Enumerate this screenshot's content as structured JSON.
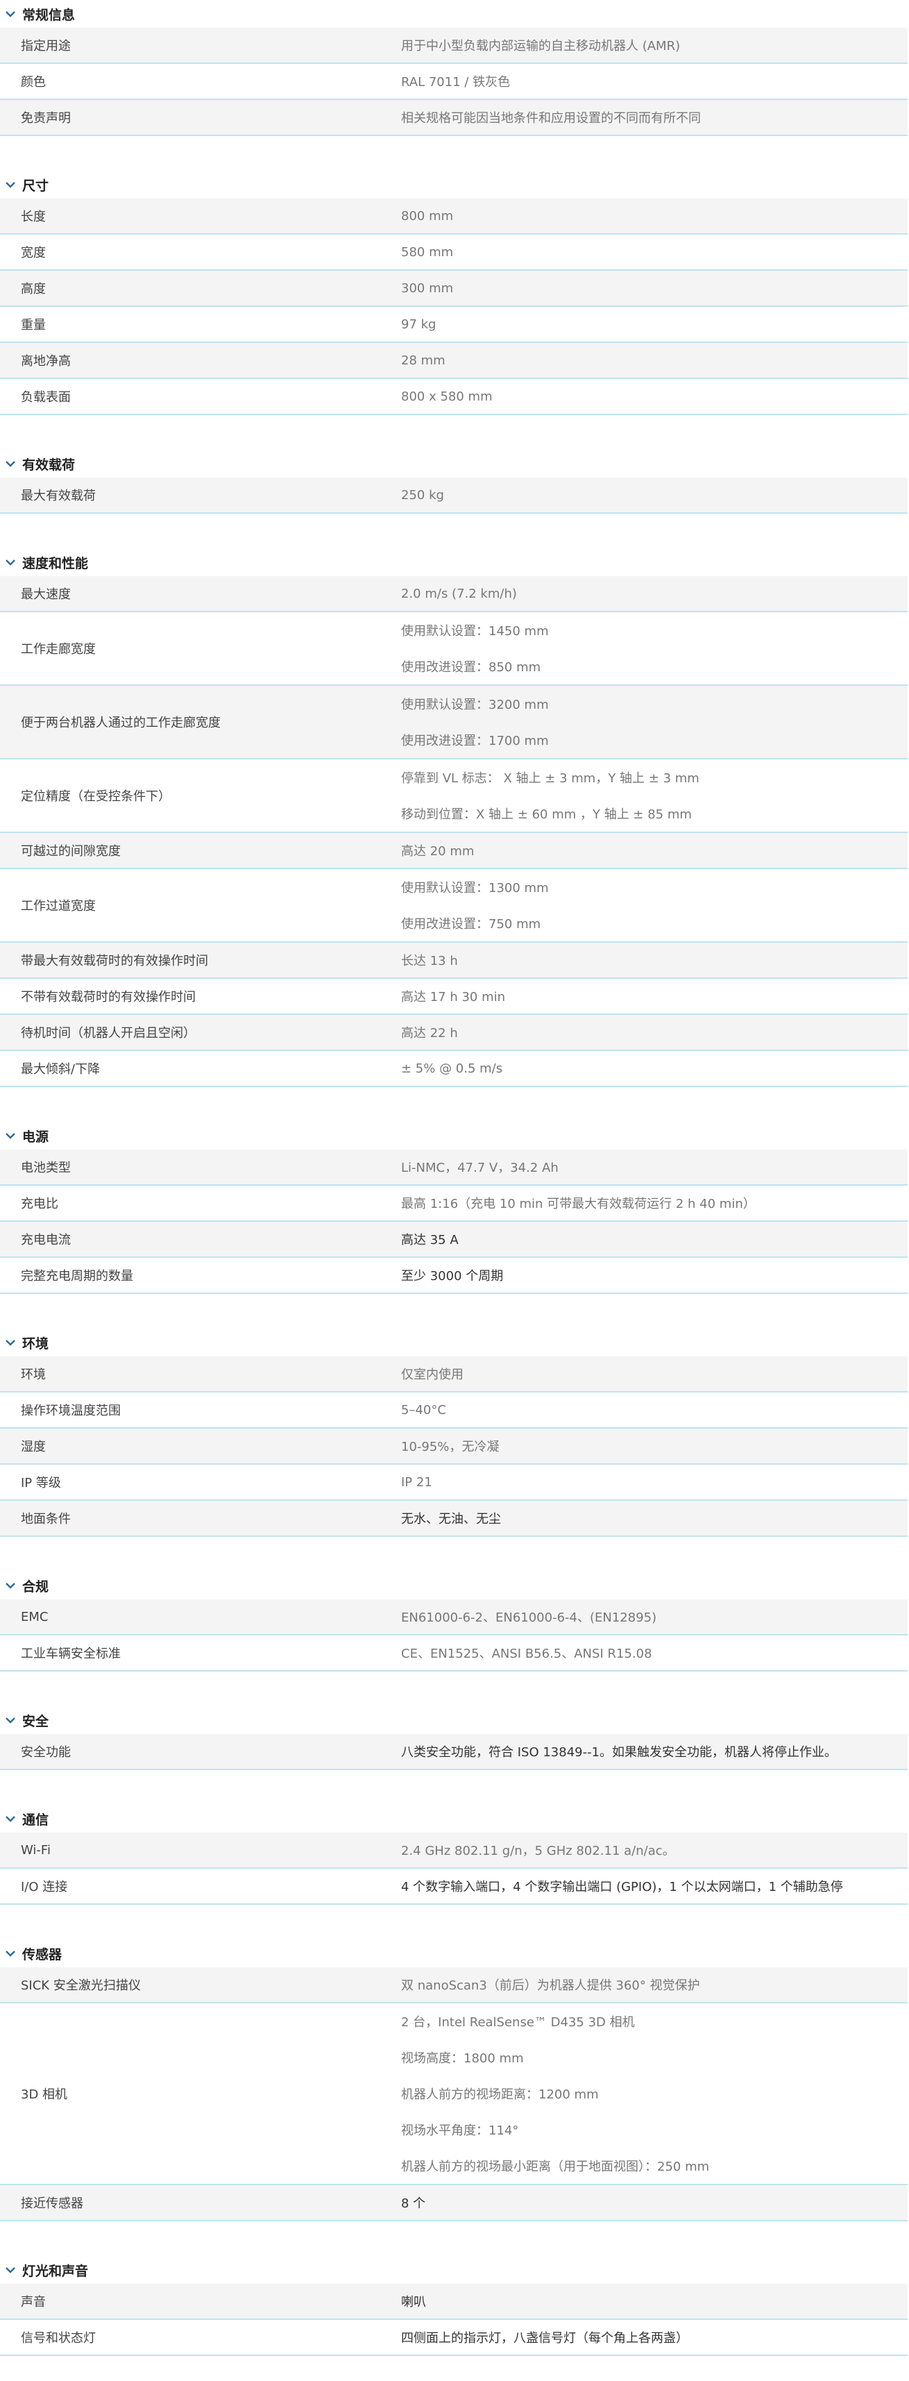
{
  "sections": [
    {
      "title": "常规信息",
      "rows": [
        {
          "k": "指定用途",
          "v": [
            "用于中小型负载内部运输的自主移动机器人 (AMR)"
          ]
        },
        {
          "k": "颜色",
          "v": [
            "RAL 7011 / 铁灰色"
          ]
        },
        {
          "k": "免责声明",
          "v": [
            "相关规格可能因当地条件和应用设置的不同而有所不同"
          ]
        }
      ]
    },
    {
      "title": "尺寸",
      "rows": [
        {
          "k": "长度",
          "v": [
            "800 mm"
          ]
        },
        {
          "k": "宽度",
          "v": [
            "580 mm"
          ]
        },
        {
          "k": "高度",
          "v": [
            "300 mm"
          ]
        },
        {
          "k": "重量",
          "v": [
            "97 kg"
          ]
        },
        {
          "k": "离地净高",
          "v": [
            "28 mm"
          ]
        },
        {
          "k": "负载表面",
          "v": [
            "800 x 580 mm"
          ]
        }
      ]
    },
    {
      "title": "有效载荷",
      "rows": [
        {
          "k": "最大有效载荷",
          "v": [
            "250 kg"
          ]
        }
      ]
    },
    {
      "title": "速度和性能",
      "rows": [
        {
          "k": "最大速度",
          "v": [
            "2.0 m/s (7.2 km/h)"
          ]
        },
        {
          "k": "工作走廊宽度",
          "v": [
            "使用默认设置：1450 mm",
            "使用改进设置：850 mm"
          ]
        },
        {
          "k": "便于两台机器人通过的工作走廊宽度",
          "v": [
            "使用默认设置：3200 mm",
            "使用改进设置：1700 mm"
          ]
        },
        {
          "k": "定位精度（在受控条件下）",
          "v": [
            "停靠到 VL 标志： X 轴上 ± 3 mm，Y 轴上 ± 3 mm",
            "移动到位置：X 轴上 ± 60 mm ，Y 轴上 ± 85 mm"
          ]
        },
        {
          "k": "可越过的间隙宽度",
          "v": [
            "高达 20 mm"
          ]
        },
        {
          "k": "工作过道宽度",
          "v": [
            "使用默认设置：1300 mm",
            "使用改进设置：750 mm"
          ]
        },
        {
          "k": "带最大有效载荷时的有效操作时间",
          "v": [
            "长达 13 h"
          ]
        },
        {
          "k": "不带有效载荷时的有效操作时间",
          "v": [
            "高达 17 h 30 min"
          ]
        },
        {
          "k": "待机时间（机器人开启且空闲）",
          "v": [
            "高达 22 h"
          ]
        },
        {
          "k": "最大倾斜/下降",
          "v": [
            "± 5% @ 0.5 m/s"
          ]
        }
      ]
    },
    {
      "title": "电源",
      "rows": [
        {
          "k": "电池类型",
          "v": [
            "Li-NMC，47.7 V，34.2 Ah"
          ]
        },
        {
          "k": "充电比",
          "v": [
            "最高 1:16（充电 10 min 可带最大有效载荷运行 2 h 40 min）"
          ]
        },
        {
          "k": "充电电流",
          "v": [
            "高达 35 A"
          ]
        },
        {
          "k": "完整充电周期的数量",
          "v": [
            "至少 3000 个周期"
          ]
        }
      ]
    },
    {
      "title": "环境",
      "rows": [
        {
          "k": "环境",
          "v": [
            "仅室内使用"
          ]
        },
        {
          "k": "操作环境温度范围",
          "v": [
            "5–40°C"
          ]
        },
        {
          "k": "湿度",
          "v": [
            "10-95%，无冷凝"
          ]
        },
        {
          "k": "IP 等级",
          "v": [
            "IP 21"
          ]
        },
        {
          "k": "地面条件",
          "v": [
            "无水、无油、无尘"
          ]
        }
      ]
    },
    {
      "title": "合规",
      "rows": [
        {
          "k": "EMC",
          "v": [
            "EN61000-6-2、EN61000-6-4、(EN12895)"
          ]
        },
        {
          "k": "工业车辆安全标准",
          "v": [
            "CE、EN1525、ANSI B56.5、ANSI R15.08"
          ]
        }
      ]
    },
    {
      "title": "安全",
      "rows": [
        {
          "k": "安全功能",
          "v": [
            "八类安全功能，符合 ISO 13849--1。如果触发安全功能，机器人将停止作业。"
          ]
        }
      ]
    },
    {
      "title": "通信",
      "rows": [
        {
          "k": "Wi-Fi",
          "v": [
            "2.4 GHz 802.11 g/n，5 GHz 802.11 a/n/ac。"
          ]
        },
        {
          "k": "I/O 连接",
          "v": [
            "4 个数字输入端口，4 个数字输出端口 (GPIO)，1 个以太网端口，1 个辅助急停"
          ]
        }
      ]
    },
    {
      "title": "传感器",
      "rows": [
        {
          "k": "SICK 安全激光扫描仪",
          "v": [
            "双 nanoScan3（前后）为机器人提供 360° 视觉保护"
          ]
        },
        {
          "k": "3D 相机",
          "v": [
            "2 台，Intel RealSense™ D435 3D 相机",
            "视场高度：1800 mm",
            "机器人前方的视场距离：1200 mm",
            "视场水平角度：114°",
            "机器人前方的视场最小距离（用于地面视图）：250 mm"
          ]
        },
        {
          "k": "接近传感器",
          "v": [
            "8 个"
          ]
        }
      ]
    },
    {
      "title": "灯光和声音",
      "rows": [
        {
          "k": "声音",
          "v": [
            "喇叭"
          ]
        },
        {
          "k": "信号和状态灯",
          "v": [
            "四侧面上的指示灯，八盏信号灯（每个角上各两盏）"
          ]
        }
      ]
    }
  ],
  "icons": {
    "section_toggle": "chevron-down-icon"
  },
  "colors": {
    "divider": "#bfe3f0",
    "stripe": "#f4f4f4",
    "chevron": "#2b6a9e"
  }
}
